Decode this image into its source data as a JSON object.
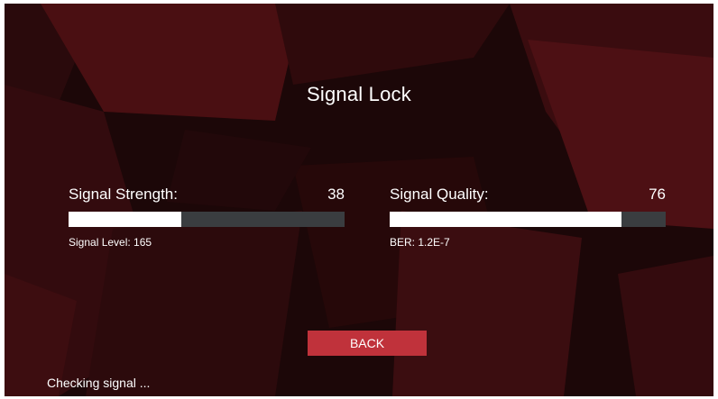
{
  "screen": {
    "title": "Signal Lock",
    "background_color": "#1c0708"
  },
  "strength": {
    "label": "Signal Strength:",
    "value": "38",
    "level_percent": 41,
    "sub_label": "Signal Level: 165"
  },
  "quality": {
    "label": "Signal Quality:",
    "value": "76",
    "level_percent": 84,
    "sub_label": "BER: 1.2E-7"
  },
  "back_button": {
    "label": "BACK",
    "color": "#c0323b"
  },
  "status": {
    "text": "Checking signal ..."
  },
  "meter_colors": {
    "fill": "#ffffff",
    "track": "#3a3d40"
  }
}
